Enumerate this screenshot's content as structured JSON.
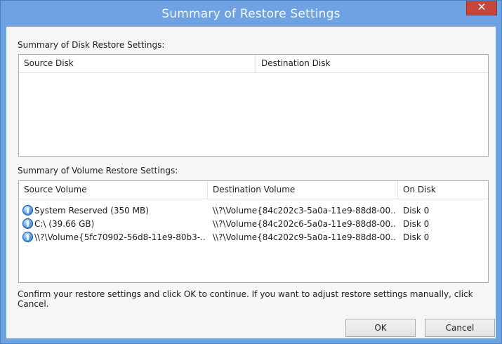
{
  "window": {
    "title": "Summary of Restore Settings",
    "close_glyph": "✕"
  },
  "disk_section": {
    "label": "Summary of Disk Restore Settings:",
    "columns": [
      "Source Disk",
      "Destination Disk"
    ],
    "rows": []
  },
  "volume_section": {
    "label": "Summary of Volume Restore Settings:",
    "columns": [
      "Source Volume",
      "Destination Volume",
      "On Disk"
    ],
    "rows": [
      {
        "source": "System Reserved (350 MB)",
        "destination": "\\\\?\\Volume{84c202c3-5a0a-11e9-88d8-00...",
        "disk": "Disk 0",
        "icon": "volume-icon"
      },
      {
        "source": "C:\\ (39.66 GB)",
        "destination": "\\\\?\\Volume{84c202c6-5a0a-11e9-88d8-00...",
        "disk": "Disk 0",
        "icon": "volume-icon"
      },
      {
        "source": "\\\\?\\Volume{5fc70902-56d8-11e9-80b3-...",
        "destination": "\\\\?\\Volume{84c202c9-5a0a-11e9-88d8-00...",
        "disk": "Disk 0",
        "icon": "volume-icon"
      }
    ]
  },
  "footer": {
    "message": "Confirm your restore settings and click OK to continue. If you want to adjust restore settings manually, click Cancel.",
    "ok_label": "OK",
    "cancel_label": "Cancel"
  }
}
